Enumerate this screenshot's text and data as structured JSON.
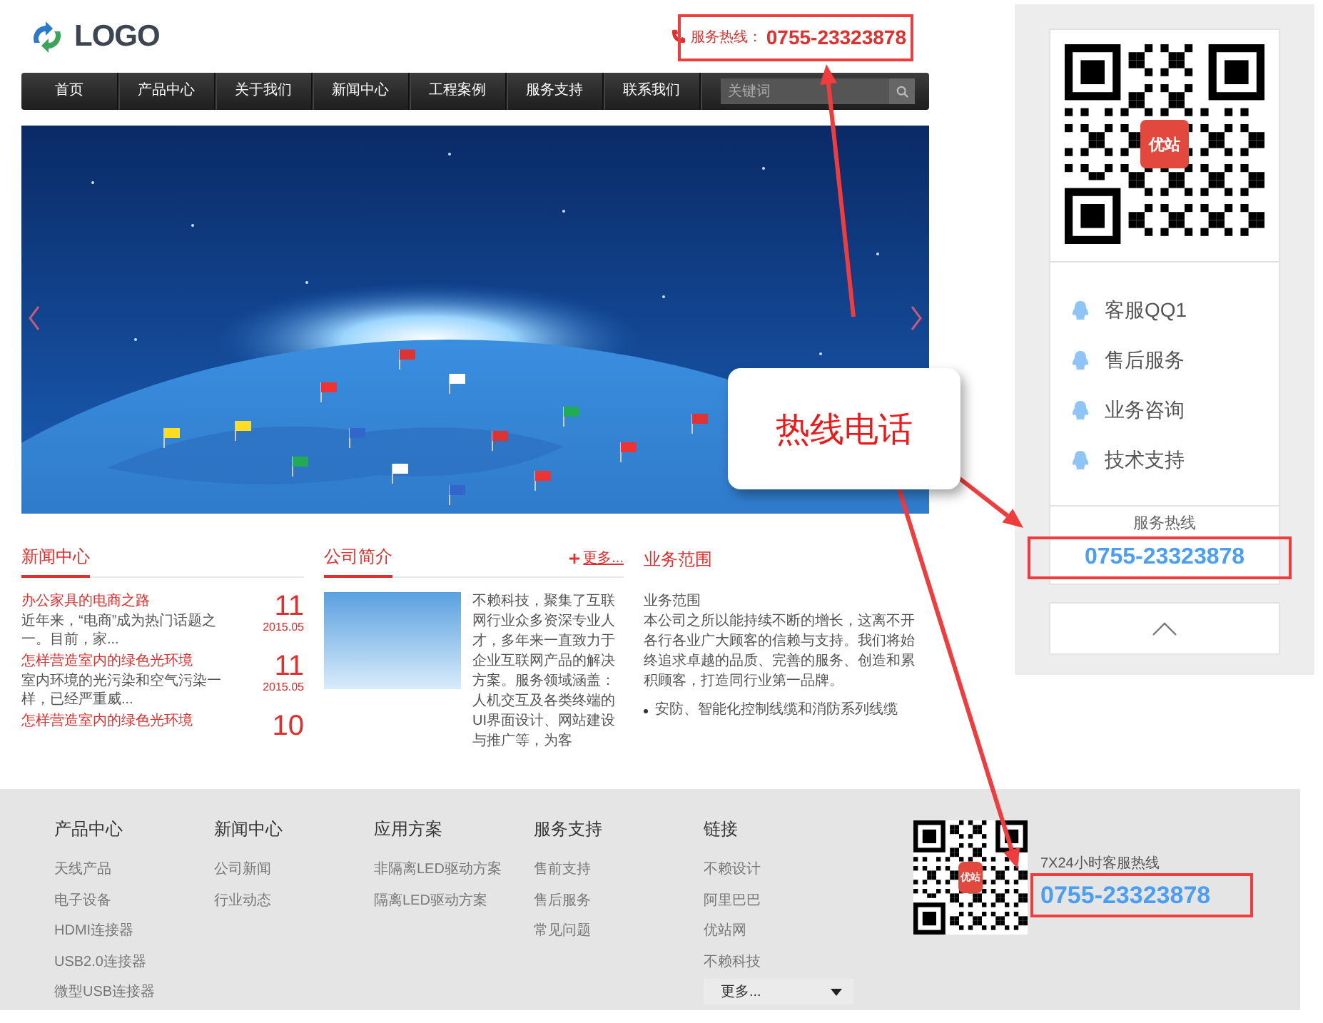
{
  "header": {
    "logo_text": "LOGO",
    "hotline_label": "服务热线：",
    "hotline_number": "0755-23323878"
  },
  "nav": {
    "items": [
      "首页",
      "产品中心",
      "关于我们",
      "新闻中心",
      "工程案例",
      "服务支持",
      "联系我们"
    ],
    "search_placeholder": "关键词"
  },
  "news": {
    "title": "新闻中心",
    "items": [
      {
        "title": "办公家具的电商之路",
        "summary": "近年来，“电商”成为热门话题之一。目前，家...",
        "day": "11",
        "month": "2015.05"
      },
      {
        "title": "怎样营造室内的绿色光环境",
        "summary": "室内环境的光污染和空气污染一样，已经严重威...",
        "day": "11",
        "month": "2015.05"
      },
      {
        "title": "怎样营造室内的绿色光环境",
        "day": "10"
      }
    ]
  },
  "company": {
    "title": "公司简介",
    "more": "更多...",
    "text": "不赖科技，聚集了互联网行业众多资深专业人才，多年来一直致力于企业互联网产品的解决方案。服务领域涵盖：人机交互及各类终端的UI界面设计、网站建设与推广等，为客"
  },
  "business": {
    "title": "业务范围",
    "subtitle": "业务范围",
    "text": "本公司之所以能持续不断的增长，这离不开各行各业广大顾客的信赖与支持。我们将始终追求卓越的品质、完善的服务、创造和累积顾客，打造同行业第一品牌。",
    "bullets": [
      "安防、智能化控制线缆和消防系列线缆"
    ]
  },
  "sidebar": {
    "qr_badge": "优站",
    "contacts": [
      "客服QQ1",
      "售后服务",
      "业务咨询",
      "技术支持"
    ],
    "hotline_label": "服务热线",
    "hotline_number": "0755-23323878"
  },
  "footer": {
    "columns": [
      {
        "title": "产品中心",
        "links": [
          "天线产品",
          "电子设备",
          "HDMI连接器",
          "USB2.0连接器",
          "微型USB连接器"
        ]
      },
      {
        "title": "新闻中心",
        "links": [
          "公司新闻",
          "行业动态"
        ]
      },
      {
        "title": "应用方案",
        "links": [
          "非隔离LED驱动方案",
          "隔离LED驱动方案"
        ]
      },
      {
        "title": "服务支持",
        "links": [
          "售前支持",
          "售后服务",
          "常见问题"
        ]
      },
      {
        "title": "链接",
        "links": [
          "不赖设计",
          "阿里巴巴",
          "优站网",
          "不赖科技"
        ],
        "more": "更多..."
      }
    ],
    "qr_badge": "优站",
    "hotline_label": "7X24小时客服热线",
    "hotline_number": "0755-23323878"
  },
  "annotation": {
    "callout": "热线电话"
  }
}
